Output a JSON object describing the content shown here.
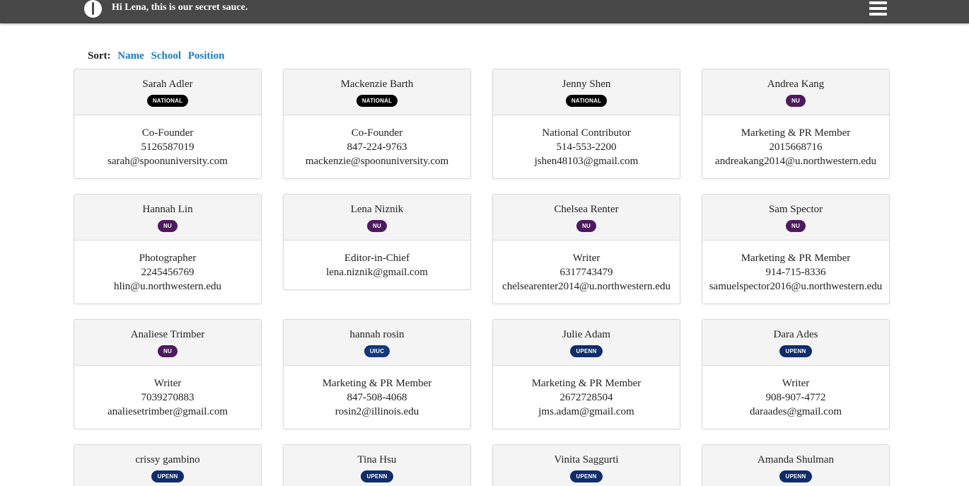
{
  "header": {
    "greeting": "Hi Lena, this is our secret sauce.",
    "logo_icon": "spoon-logo-icon",
    "menu_icon": "hamburger-menu-icon",
    "bg_color": "#484848"
  },
  "sort": {
    "label": "Sort:",
    "options": [
      "Name",
      "School",
      "Position"
    ],
    "link_color": "#1a7ac7"
  },
  "badge_colors": {
    "NATIONAL": "#000000",
    "NU": "#4e1a5e",
    "UIUC": "#13387a",
    "UPENN": "#0f2d6b"
  },
  "members": [
    {
      "name": "Sarah Adler",
      "badge": "NATIONAL",
      "lines": [
        "Co-Founder",
        "5126587019",
        "sarah@spoonuniversity.com"
      ]
    },
    {
      "name": "Mackenzie Barth",
      "badge": "NATIONAL",
      "lines": [
        "Co-Founder",
        "847-224-9763",
        "mackenzie@spoonuniversity.com"
      ]
    },
    {
      "name": "Jenny Shen",
      "badge": "NATIONAL",
      "lines": [
        "National Contributor",
        "514-553-2200",
        "jshen48103@gmail.com"
      ]
    },
    {
      "name": "Andrea Kang",
      "badge": "NU",
      "lines": [
        "Marketing & PR Member",
        "2015668716",
        "andreakang2014@u.northwestern.edu"
      ]
    },
    {
      "name": "Hannah Lin",
      "badge": "NU",
      "lines": [
        "Photographer",
        "2245456769",
        "hlin@u.northwestern.edu"
      ]
    },
    {
      "name": "Lena Niznik",
      "badge": "NU",
      "lines": [
        "Editor-in-Chief",
        "lena.niznik@gmail.com"
      ]
    },
    {
      "name": "Chelsea Renter",
      "badge": "NU",
      "lines": [
        "Writer",
        "6317743479",
        "chelsearenter2014@u.northwestern.edu"
      ]
    },
    {
      "name": "Sam Spector",
      "badge": "NU",
      "lines": [
        "Marketing & PR Member",
        "914-715-8336",
        "samuelspector2016@u.northwestern.edu"
      ]
    },
    {
      "name": "Analiese Trimber",
      "badge": "NU",
      "lines": [
        "Writer",
        "7039270883",
        "analiesetrimber@gmail.com"
      ]
    },
    {
      "name": "hannah rosin",
      "badge": "UIUC",
      "lines": [
        "Marketing & PR Member",
        "847-508-4068",
        "rosin2@illinois.edu"
      ]
    },
    {
      "name": "Julie Adam",
      "badge": "UPENN",
      "lines": [
        "Marketing & PR Member",
        "2672728504",
        "jms.adam@gmail.com"
      ]
    },
    {
      "name": "Dara Ades",
      "badge": "UPENN",
      "lines": [
        "Writer",
        "908-907-4772",
        "daraades@gmail.com"
      ]
    },
    {
      "name": "crissy gambino",
      "badge": "UPENN",
      "lines": []
    },
    {
      "name": "Tina Hsu",
      "badge": "UPENN",
      "lines": []
    },
    {
      "name": "Vinita Saggurti",
      "badge": "UPENN",
      "lines": []
    },
    {
      "name": "Amanda Shulman",
      "badge": "UPENN",
      "lines": []
    }
  ]
}
